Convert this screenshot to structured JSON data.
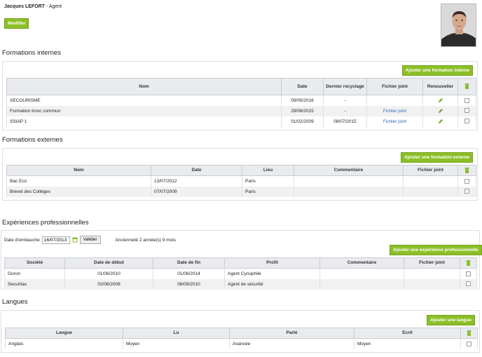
{
  "header": {
    "name": "Jacques LEFORT",
    "separator": " - ",
    "role": "Agent",
    "edit_label": "Modifier"
  },
  "formations_internes": {
    "title": "Formations internes",
    "add_label": "Ajouter une formation interne",
    "columns": [
      "Nom",
      "Date",
      "Dernier recyclage",
      "Fichier joint",
      "Renouveller"
    ],
    "rows": [
      {
        "nom": "SECOURISME",
        "date": "09/05/2016",
        "recyclage": "-",
        "fichier": ""
      },
      {
        "nom": "Formation tronc commun",
        "date": "29/06/2015",
        "recyclage": "-",
        "fichier": "Fichier joint"
      },
      {
        "nom": "SSIAP 1",
        "date": "01/02/2009",
        "recyclage": "08/07/2015",
        "fichier": "Fichier joint"
      }
    ]
  },
  "formations_externes": {
    "title": "Formations externes",
    "add_label": "Ajouter une formation externe",
    "columns": [
      "Nom",
      "Date",
      "Lieu",
      "Commentaire",
      "Fichier joint"
    ],
    "rows": [
      {
        "nom": "Bac Eco",
        "date": "13/07/2012",
        "lieu": "Paris",
        "commentaire": "",
        "fichier": ""
      },
      {
        "nom": "Brevet des Collèges",
        "date": "07/07/2009",
        "lieu": "Paris",
        "commentaire": "",
        "fichier": ""
      }
    ]
  },
  "experiences": {
    "title": "Expériences professionnelles",
    "embauche_label": "Date d'embauche",
    "embauche_value": "16/07/2013",
    "validate_label": "Valider",
    "anciennete": "Ancienneté 2 année(s) 9 mois",
    "add_label": "Ajouter une expérience professionnelle",
    "columns": [
      "Société",
      "Date de début",
      "Date de fin",
      "Profil",
      "Commentaire",
      "Fichier joint"
    ],
    "rows": [
      {
        "societe": "Goron",
        "debut": "01/06/2010",
        "fin": "01/06/2014",
        "profil": "Agent Cynophile",
        "commentaire": "",
        "fichier": ""
      },
      {
        "societe": "Securitas",
        "debut": "02/06/2008",
        "fin": "06/09/2010",
        "profil": "Agent de sécurité",
        "commentaire": "",
        "fichier": ""
      }
    ]
  },
  "langues": {
    "title": "Langues",
    "add_label": "Ajouter une langue",
    "columns": [
      "Langue",
      "Lu",
      "Parlé",
      "Ecrit"
    ],
    "rows": [
      {
        "langue": "Anglais",
        "lu": "Moyen",
        "parle": "Avancée",
        "ecrit": "Moyen"
      }
    ]
  },
  "colors": {
    "accent": "#8cbf28",
    "link": "#2a6ebb",
    "header_bg": "#e9ebee"
  },
  "icons": {
    "delete": "trash-icon",
    "renew": "pencil-icon",
    "calendar": "calendar-icon"
  }
}
